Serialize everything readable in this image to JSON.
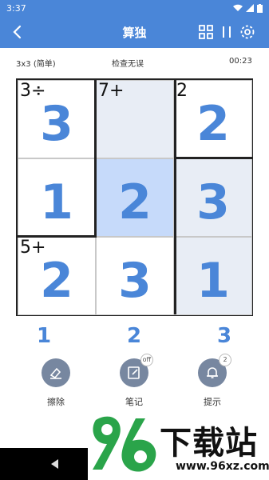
{
  "status": {
    "time": "3:37"
  },
  "appbar": {
    "title": "算独"
  },
  "info": {
    "size": "3x3 (简单)",
    "status": "检查无误",
    "timer": "00:23"
  },
  "board": {
    "cells": [
      {
        "value": "3",
        "clue": "3÷",
        "bg": "white"
      },
      {
        "value": "",
        "clue": "7+",
        "bg": "shade"
      },
      {
        "value": "2",
        "clue": "2",
        "bg": "white"
      },
      {
        "value": "1",
        "clue": "",
        "bg": "white"
      },
      {
        "value": "2",
        "clue": "",
        "bg": "selected"
      },
      {
        "value": "3",
        "clue": "",
        "bg": "shade"
      },
      {
        "value": "2",
        "clue": "5+",
        "bg": "white"
      },
      {
        "value": "3",
        "clue": "",
        "bg": "white"
      },
      {
        "value": "1",
        "clue": "",
        "bg": "shade"
      }
    ]
  },
  "numbers": [
    "1",
    "2",
    "3"
  ],
  "tools": {
    "erase": {
      "label": "擦除"
    },
    "notes": {
      "label": "笔记",
      "badge": "off"
    },
    "hint": {
      "label": "提示",
      "badge": "2"
    }
  },
  "watermark": {
    "brand": "下载站",
    "url": "www.96xz.com"
  },
  "colors": {
    "accent": "#4a86d8",
    "tool": "#7787a0"
  }
}
